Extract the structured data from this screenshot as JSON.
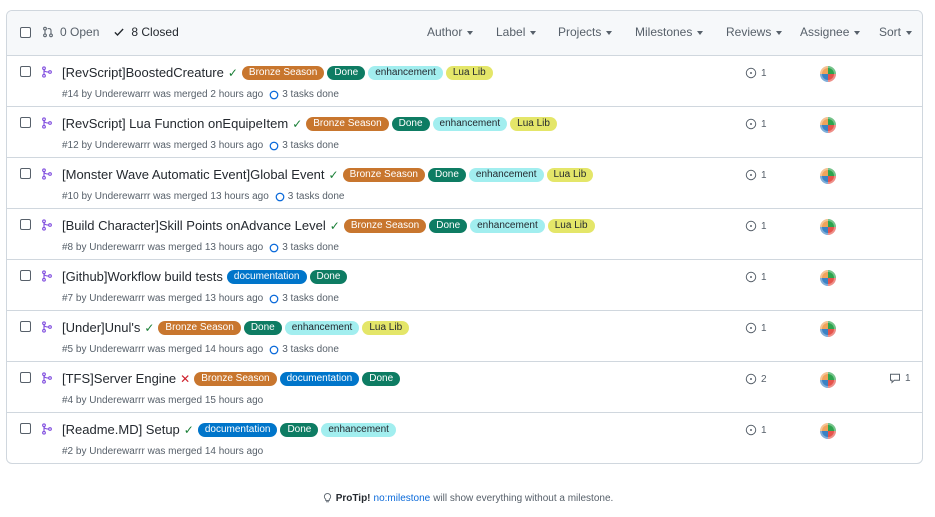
{
  "header": {
    "open": "0 Open",
    "closed": "8 Closed",
    "filters": [
      "Author",
      "Label",
      "Projects",
      "Milestones",
      "Reviews",
      "Assignee",
      "Sort"
    ]
  },
  "colors": {
    "bronze": "#c8762e",
    "done": "#0e7c63",
    "enhancement": "#a2eeef",
    "lualib": "#e4e669",
    "documentation": "#0075ca",
    "merged_icon": "#8250df"
  },
  "prs": [
    {
      "title": "[RevScript]BoostedCreature",
      "status": "✓",
      "labels": [
        "Bronze Season",
        "Done",
        "enhancement",
        "Lua Lib"
      ],
      "meta": "#14 by Underewarrr was merged 2 hours ago",
      "tasks": "3 tasks done",
      "reviews": "1",
      "comments": ""
    },
    {
      "title": "[RevScript] Lua Function onEquipeItem",
      "status": "✓",
      "labels": [
        "Bronze Season",
        "Done",
        "enhancement",
        "Lua Lib"
      ],
      "meta": "#12 by Underewarrr was merged 3 hours ago",
      "tasks": "3 tasks done",
      "reviews": "1",
      "comments": ""
    },
    {
      "title": "[Monster Wave Automatic Event]Global Event",
      "status": "✓",
      "labels": [
        "Bronze Season",
        "Done",
        "enhancement",
        "Lua Lib"
      ],
      "meta": "#10 by Underewarrr was merged 13 hours ago",
      "tasks": "3 tasks done",
      "reviews": "1",
      "comments": ""
    },
    {
      "title": "[Build Character]Skill Points onAdvance Level",
      "status": "✓",
      "labels": [
        "Bronze Season",
        "Done",
        "enhancement",
        "Lua Lib"
      ],
      "meta": "#8 by Underewarrr was merged 13 hours ago",
      "tasks": "3 tasks done",
      "reviews": "1",
      "comments": ""
    },
    {
      "title": "[Github]Workflow build tests",
      "status": "",
      "labels": [
        "documentation",
        "Done"
      ],
      "meta": "#7 by Underewarrr was merged 13 hours ago",
      "tasks": "3 tasks done",
      "reviews": "1",
      "comments": ""
    },
    {
      "title": "[Under]Unul's",
      "status": "✓",
      "labels": [
        "Bronze Season",
        "Done",
        "enhancement",
        "Lua Lib"
      ],
      "meta": "#5 by Underewarrr was merged 14 hours ago",
      "tasks": "3 tasks done",
      "reviews": "1",
      "comments": ""
    },
    {
      "title": "[TFS]Server Engine",
      "status": "✕",
      "labels": [
        "Bronze Season",
        "documentation",
        "Done"
      ],
      "meta": "#4 by Underewarrr was merged 15 hours ago",
      "tasks": "",
      "reviews": "2",
      "comments": "1"
    },
    {
      "title": "[Readme.MD] Setup",
      "status": "✓",
      "labels": [
        "documentation",
        "Done",
        "enhancement"
      ],
      "meta": "#2 by Underewarrr was merged 14 hours ago",
      "tasks": "",
      "reviews": "1",
      "comments": ""
    }
  ],
  "protip": {
    "bold": "ProTip!",
    "link": "no:milestone",
    "text": "will show everything without a milestone."
  }
}
